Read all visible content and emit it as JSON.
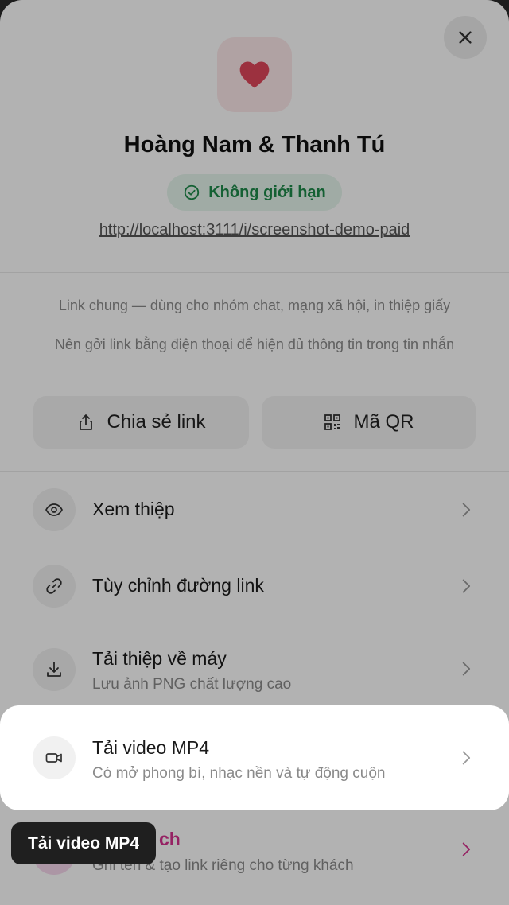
{
  "card": {
    "title": "Hoàng Nam & Thanh Tú",
    "badge": "Không giới hạn",
    "url": "http://localhost:3111/i/screenshot-demo-paid"
  },
  "hints": {
    "line1": "Link chung — dùng cho nhóm chat, mạng xã hội, in thiệp giấy",
    "line2": "Nên gởi link bằng điện thoại để hiện đủ thông tin trong tin nhắn"
  },
  "actions": {
    "share": "Chia sẻ link",
    "qr": "Mã QR"
  },
  "menu": [
    {
      "label": "Xem thiệp",
      "sub": "",
      "icon": "eye-icon"
    },
    {
      "label": "Tùy chỉnh đường link",
      "sub": "",
      "icon": "link-icon"
    },
    {
      "label": "Tải thiệp về máy",
      "sub": "Lưu ảnh PNG chất lượng cao",
      "icon": "download-icon"
    },
    {
      "label": "Tải video MP4",
      "sub": "Có mở phong bì, nhạc nền và tự động cuộn",
      "icon": "video-icon"
    },
    {
      "label": "ch",
      "sub": "Ghi tên & tạo link riêng cho từng khách",
      "icon": "guest-icon"
    }
  ],
  "tooltip": "Tải video MP4",
  "colors": {
    "heart": "#e0475b",
    "badge_text": "#1d8a4a",
    "guest_accent": "#d6318e"
  }
}
